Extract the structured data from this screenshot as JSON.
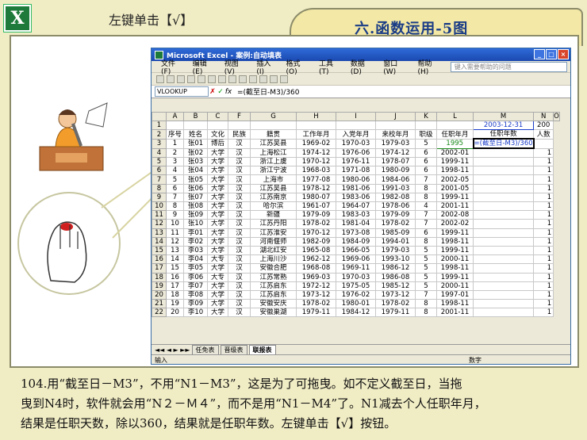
{
  "header": {
    "logo_letter": "X",
    "instruction": "左键单击【√】",
    "section_title": "六.函数运用-5图"
  },
  "excel": {
    "window_title": "Microsoft Excel - 案例:自动填表",
    "menu": [
      "文件(F)",
      "编辑(E)",
      "视图(V)",
      "插入(I)",
      "格式(O)",
      "工具(T)",
      "数据(D)",
      "窗口(W)",
      "帮助(H)"
    ],
    "help_placeholder": "键入需要帮助的问题",
    "name_box": "VLOOKUP",
    "cancel_glyph": "✗",
    "enter_glyph": "✓",
    "fx_label": "fx",
    "formula": "=(截至日-M3)/360",
    "columns": [
      "A",
      "B",
      "C",
      "F",
      "G",
      "H",
      "I",
      "J",
      "K",
      "L",
      "M",
      "N",
      "O"
    ],
    "row1": {
      "n": "2003-12-31",
      "o": "200"
    },
    "headers": [
      "序号",
      "姓名",
      "文化",
      "民族",
      "籍贯",
      "工作年月",
      "入党年月",
      "来校年月",
      "职级",
      "任职年月",
      "任职年数",
      "人数"
    ],
    "rows": [
      [
        "1",
        "张01",
        "博后",
        "汉",
        "江苏吴县",
        "1969-02",
        "1970-03",
        "1979-03",
        "5",
        "1995",
        "=(截至日-M3)/360",
        ""
      ],
      [
        "2",
        "张02",
        "大学",
        "汉",
        "上海松江",
        "1974-12",
        "1976-06",
        "1974-12",
        "6",
        "2002-01",
        "",
        "1"
      ],
      [
        "3",
        "张03",
        "大学",
        "汉",
        "浙江上虞",
        "1970-12",
        "1976-11",
        "1978-07",
        "6",
        "1999-11",
        "",
        "1"
      ],
      [
        "4",
        "张04",
        "大学",
        "汉",
        "浙江宁波",
        "1968-03",
        "1971-08",
        "1980-09",
        "6",
        "1998-11",
        "",
        "1"
      ],
      [
        "5",
        "张05",
        "大学",
        "汉",
        "上海市",
        "1977-08",
        "1980-06",
        "1984-06",
        "7",
        "2002-05",
        "",
        "1"
      ],
      [
        "6",
        "张06",
        "大学",
        "汉",
        "江苏吴县",
        "1978-12",
        "1981-06",
        "1991-03",
        "8",
        "2001-05",
        "",
        "1"
      ],
      [
        "7",
        "张07",
        "大学",
        "汉",
        "江苏南京",
        "1980-07",
        "1983-06",
        "1982-08",
        "8",
        "1999-11",
        "",
        "1"
      ],
      [
        "8",
        "张08",
        "大学",
        "汉",
        "哈尔滨",
        "1961-07",
        "1964-07",
        "1978-06",
        "4",
        "2001-11",
        "",
        "1"
      ],
      [
        "9",
        "张09",
        "大学",
        "汉",
        "新疆",
        "1979-09",
        "1983-03",
        "1979-09",
        "7",
        "2002-08",
        "",
        "1"
      ],
      [
        "10",
        "张10",
        "大学",
        "汉",
        "江苏丹阳",
        "1978-02",
        "1981-04",
        "1978-02",
        "7",
        "2002-02",
        "",
        "1"
      ],
      [
        "11",
        "李01",
        "大学",
        "汉",
        "江苏淮安",
        "1970-12",
        "1973-08",
        "1985-09",
        "6",
        "1999-11",
        "",
        "1"
      ],
      [
        "12",
        "李02",
        "大学",
        "汉",
        "河南偃师",
        "1982-09",
        "1984-09",
        "1994-01",
        "8",
        "1998-11",
        "",
        "1"
      ],
      [
        "13",
        "李03",
        "大学",
        "汉",
        "湖北红安",
        "1965-08",
        "1966-05",
        "1979-03",
        "5",
        "1999-11",
        "",
        "1"
      ],
      [
        "14",
        "李04",
        "大专",
        "汉",
        "上海川沙",
        "1962-12",
        "1969-06",
        "1993-10",
        "5",
        "2000-11",
        "",
        "1"
      ],
      [
        "15",
        "李05",
        "大学",
        "汉",
        "安徽合肥",
        "1968-08",
        "1969-11",
        "1986-12",
        "5",
        "1998-11",
        "",
        "1"
      ],
      [
        "16",
        "李06",
        "大专",
        "汉",
        "江苏常熟",
        "1969-03",
        "1970-03",
        "1986-08",
        "5",
        "1999-11",
        "",
        "1"
      ],
      [
        "17",
        "李07",
        "大学",
        "汉",
        "江苏启东",
        "1972-12",
        "1975-05",
        "1985-12",
        "5",
        "2000-11",
        "",
        "1"
      ],
      [
        "18",
        "李08",
        "大学",
        "汉",
        "江苏启东",
        "1973-12",
        "1976-02",
        "1973-12",
        "7",
        "1997-01",
        "",
        "1"
      ],
      [
        "19",
        "李09",
        "大学",
        "汉",
        "安徽安庆",
        "1978-02",
        "1980-01",
        "1978-02",
        "8",
        "1998-11",
        "",
        "1"
      ],
      [
        "20",
        "李10",
        "大学",
        "汉",
        "安徽巢湖",
        "1979-11",
        "1984-12",
        "1979-11",
        "8",
        "2001-11",
        "",
        "1"
      ]
    ],
    "sheet_tabs": [
      "任免表",
      "晋级表",
      "联报表"
    ],
    "status_left": "输入",
    "status_mode": "数字"
  },
  "footer": {
    "line1": "104.用“截至日－M3”，不用“N1－M3”，这是为了可拖曳。如不定义截至日，当拖",
    "line2": "曳到N4时，软件就会用“N２－Ｍ４”，而不是用“N1－M4”了。N1减去个人任职年月，",
    "line3": "结果是任职天数，除以360，结果就是任职年数。左键单击【√】按钮。"
  }
}
